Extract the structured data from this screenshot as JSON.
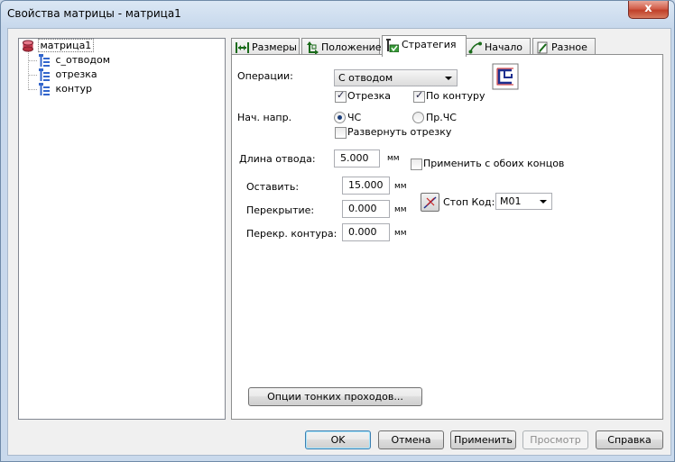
{
  "window": {
    "title": "Свойства матрицы - матрица1",
    "close_glyph": "x"
  },
  "tree": {
    "root": "матрица1",
    "children": [
      "с_отводом",
      "отрезка",
      "контур"
    ]
  },
  "tabs": [
    {
      "label": "Размеры",
      "icon": "dimensions-icon"
    },
    {
      "label": "Положение",
      "icon": "position-icon"
    },
    {
      "label": "Стратегия",
      "icon": "strategy-icon",
      "active": true
    },
    {
      "label": "Начало",
      "icon": "start-icon"
    },
    {
      "label": "Разное",
      "icon": "misc-icon"
    }
  ],
  "strategy": {
    "operations_label": "Операции:",
    "operations_value": "С отводом",
    "chk_cut_label": "Отрезка",
    "chk_cut_checked": true,
    "chk_contour_label": "По контуру",
    "chk_contour_checked": true,
    "start_dir_label": "Нач. напр.",
    "radio_cw_label": "ЧС",
    "radio_cw_selected": true,
    "radio_ccw_label": "Пр.ЧС",
    "reverse_cut_label": "Развернуть отрезку",
    "reverse_cut_checked": false,
    "lead_length_label": "Длина отвода:",
    "lead_length_value": "5.000",
    "lead_length_unit": "мм",
    "both_ends_label": "Применить с обоих концов",
    "both_ends_checked": false,
    "leave_label": "Оставить:",
    "leave_value": "15.000",
    "leave_unit": "мм",
    "overlap_label": "Перекрытие:",
    "overlap_value": "0.000",
    "overlap_unit": "мм",
    "contour_overlap_label": "Перекр. контура:",
    "contour_overlap_value": "0.000",
    "contour_overlap_unit": "мм",
    "stop_code_label": "Стоп Код:",
    "stop_code_value": "M01",
    "fine_passes_button": "Опции тонких проходов..."
  },
  "buttons": {
    "ok": "OK",
    "cancel": "Отмена",
    "apply": "Применить",
    "preview": "Просмотр",
    "help": "Справка"
  },
  "colors": {
    "accent_border": "#3c7fb1",
    "close_red": "#c0402a",
    "disabled_text": "#8d8d8d"
  }
}
